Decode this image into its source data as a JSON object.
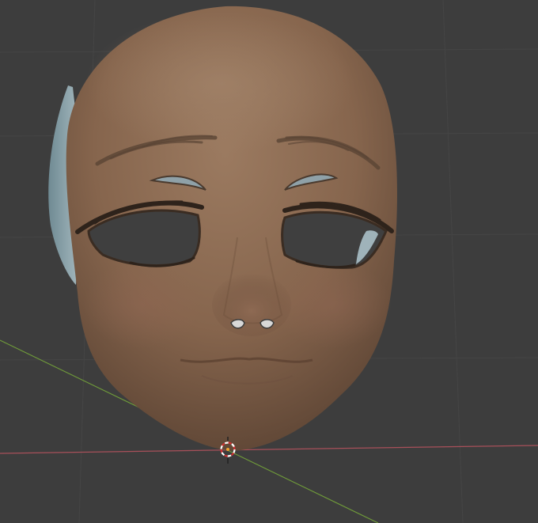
{
  "viewport": {
    "background_color": "#3d3d3d",
    "grid_line_color": "#464646",
    "x_axis_color": "#a8505a",
    "y_axis_color": "#6f9a3a"
  },
  "scene": {
    "object": "face-mesh",
    "skin_color": "#8c6b52",
    "inner_shell_color": "#8fa5ad",
    "cursor": "3d-cursor-icon"
  }
}
